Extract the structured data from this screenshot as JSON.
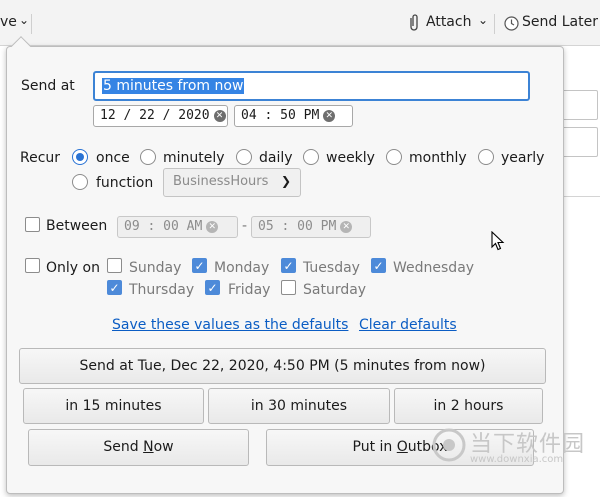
{
  "toolbar": {
    "partial_left": "ve",
    "attach_label": "Attach",
    "send_later_label": "Send Later"
  },
  "send_at": {
    "label": "Send at",
    "value": "5 minutes from now",
    "date": "12 / 22 / 2020",
    "time": "04 : 50   PM"
  },
  "recur": {
    "label": "Recur",
    "options": [
      "once",
      "minutely",
      "daily",
      "weekly",
      "monthly",
      "yearly"
    ],
    "selected": "once",
    "function_label": "function",
    "function_select": "BusinessHours"
  },
  "between": {
    "label": "Between",
    "start": "09 : 00   AM",
    "end": "05 : 00   PM",
    "separator": "-"
  },
  "only_on": {
    "label": "Only on",
    "days": {
      "sunday": "Sunday",
      "monday": "Monday",
      "tuesday": "Tuesday",
      "wednesday": "Wednesday",
      "thursday": "Thursday",
      "friday": "Friday",
      "saturday": "Saturday"
    }
  },
  "links": {
    "save_defaults": "Save these values as the defaults",
    "clear_defaults": "Clear defaults"
  },
  "buttons": {
    "send_at": "Send at Tue, Dec 22, 2020, 4:50 PM (5 minutes from now)",
    "in15": "in 15 minutes",
    "in30": "in 30 minutes",
    "in2h": "in 2 hours",
    "send_now_pre": "Send ",
    "send_now_u": "N",
    "send_now_post": "ow",
    "outbox_pre": "Put in ",
    "outbox_u": "O",
    "outbox_post": "utbox"
  },
  "watermark": {
    "title": "当下软件园",
    "url": "www.downxia.com"
  },
  "colors": {
    "accent": "#2a73d4",
    "link": "#0b5dc4",
    "focus": "#3c83d5"
  }
}
